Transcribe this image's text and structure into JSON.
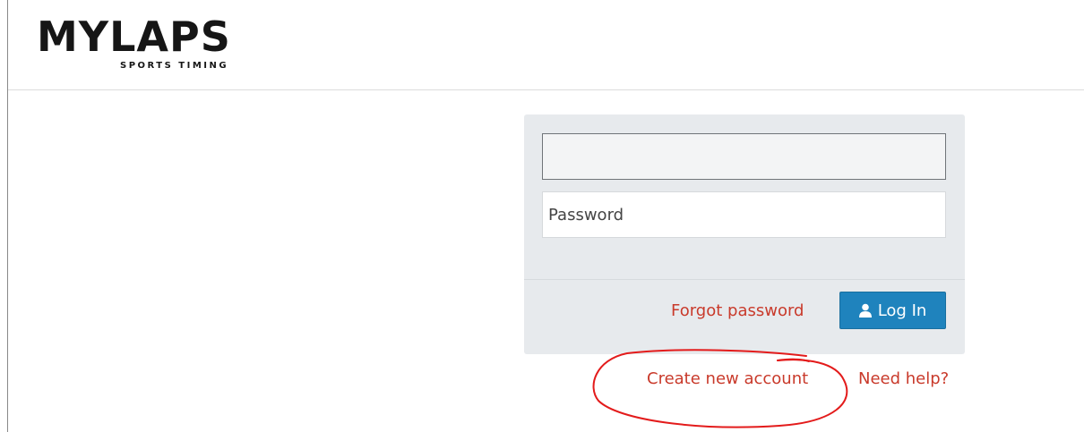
{
  "brand": {
    "logo_name": "MYLAPS",
    "tagline": "SPORTS TIMING",
    "color": "#161616",
    "accent": "#d63a2a"
  },
  "login": {
    "username_value": "",
    "password_placeholder": "Password",
    "forgot_label": "Forgot password",
    "login_label": "Log In",
    "login_icon": "user-icon"
  },
  "links": {
    "create_account": "Create new account",
    "need_help": "Need help?"
  },
  "colors": {
    "link": "#c93a2b",
    "button": "#1f83bd",
    "panel": "#e7eaed",
    "annotation": "#e31b1b"
  }
}
